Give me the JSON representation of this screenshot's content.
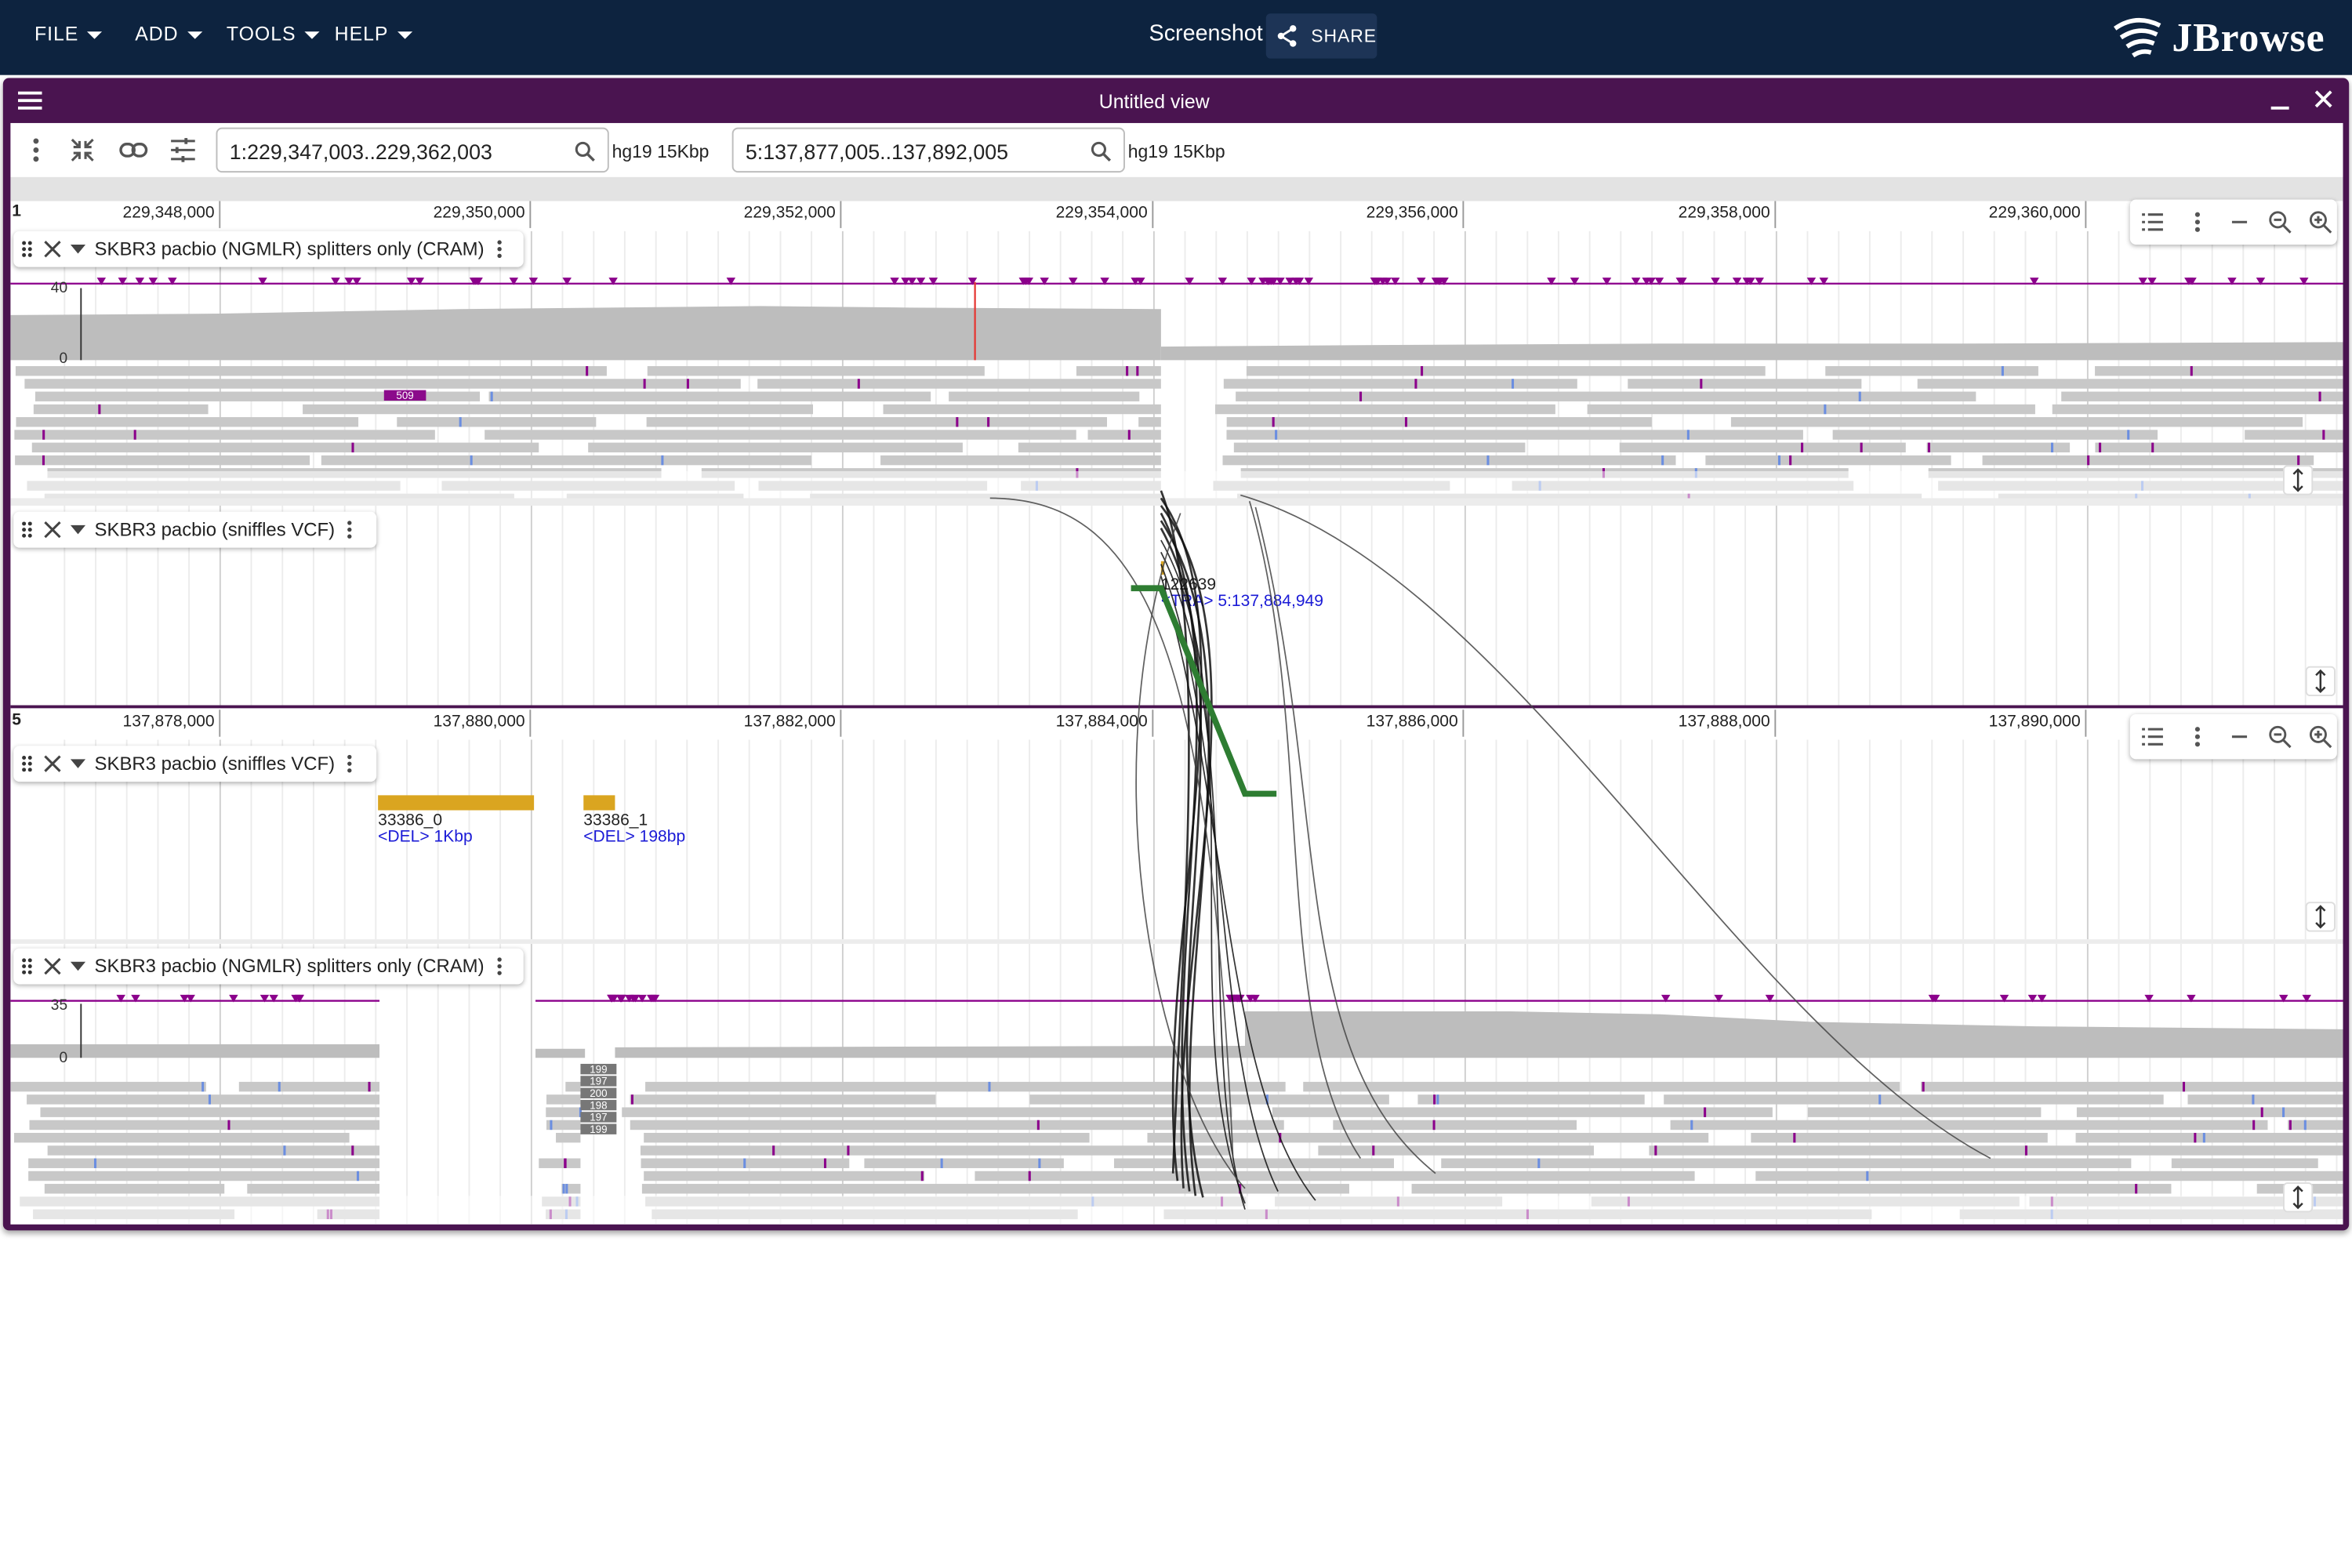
{
  "appbar": {
    "menus": [
      "FILE",
      "ADD",
      "TOOLS",
      "HELP"
    ],
    "title": "Screenshot",
    "share_label": "SHARE",
    "logo_text": "JBrowse"
  },
  "view": {
    "title": "Untitled view",
    "top": {
      "locstring": "1:229,347,003..229,362,003",
      "assembly_span": "hg19 15Kbp",
      "chrom": "1",
      "ruler_labels": [
        "229,348,000",
        "229,350,000",
        "229,352,000",
        "229,354,000",
        "229,356,000",
        "229,358,000",
        "229,360,000"
      ],
      "tracks": [
        {
          "name": "SKBR3 pacbio (NGMLR) splitters only (CRAM)",
          "max": "40",
          "min": "0",
          "insertion_label": "509"
        },
        {
          "name": "SKBR3 pacbio (sniffles VCF)"
        }
      ],
      "variant": {
        "id": "122639",
        "desc": "<TRA> 5:137,884,949"
      }
    },
    "bottom": {
      "locstring": "5:137,877,005..137,892,005",
      "assembly_span": "hg19 15Kbp",
      "chrom": "5",
      "ruler_labels": [
        "137,878,000",
        "137,880,000",
        "137,882,000",
        "137,884,000",
        "137,886,000",
        "137,888,000",
        "137,890,000"
      ],
      "tracks": [
        {
          "name": "SKBR3 pacbio (sniffles VCF)"
        },
        {
          "name": "SKBR3 pacbio (NGMLR) splitters only (CRAM)",
          "max": "35",
          "min": "0",
          "softclip_labels": [
            "199",
            "197",
            "200",
            "198",
            "197",
            "199"
          ]
        }
      ],
      "variants": [
        {
          "id": "33386_0",
          "desc": "<DEL> 1Kbp"
        },
        {
          "id": "33386_1",
          "desc": "<DEL> 198bp"
        }
      ]
    }
  },
  "colors": {
    "appbar": "#0d233f",
    "view_header": "#4a1450",
    "variant_fill": "#daa520",
    "translocation_line": "#2e7d32",
    "variant_desc": "#1a1ad6",
    "read": "#c8c8c8",
    "coverage": "#bdbdbd"
  }
}
